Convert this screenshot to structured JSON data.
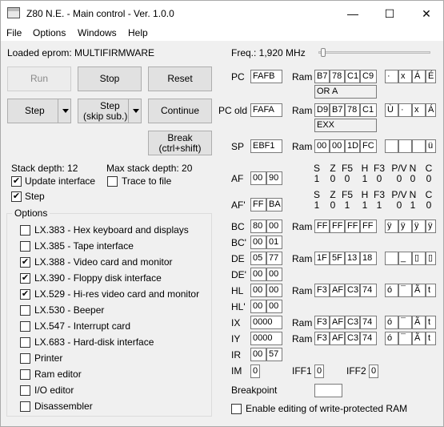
{
  "window": {
    "title": "Z80 N.E. - Main control - Ver. 1.0.0",
    "minimize": "—",
    "maximize": "☐",
    "close": "✕"
  },
  "menu": [
    "File",
    "Options",
    "Windows",
    "Help"
  ],
  "loaded": "Loaded eprom: MULTIFIRMWARE",
  "buttons": {
    "run": "Run",
    "stop": "Stop",
    "reset": "Reset",
    "step": "Step",
    "step_skip_1": "Step",
    "step_skip_2": "(skip sub.)",
    "continue": "Continue",
    "break_1": "Break",
    "break_2": "(ctrl+shift)"
  },
  "stack_depth": "Stack depth: 12",
  "max_stack_depth": "Max stack depth: 20",
  "update_interface": {
    "label": "Update interface",
    "checked": "✔"
  },
  "trace_to_file": {
    "label": "Trace to file",
    "checked": ""
  },
  "step_check": {
    "label": "Step",
    "checked": "✔"
  },
  "options": {
    "title": "Options",
    "items": [
      {
        "label": "LX.383 - Hex keyboard and displays",
        "checked": ""
      },
      {
        "label": "LX.385 - Tape interface",
        "checked": ""
      },
      {
        "label": "LX.388 - Video card and monitor",
        "checked": "✔"
      },
      {
        "label": "LX.390 - Floppy disk interface",
        "checked": "✔"
      },
      {
        "label": "LX.529 - Hi-res video card and monitor",
        "checked": "✔"
      },
      {
        "label": "LX.530 - Beeper",
        "checked": ""
      },
      {
        "label": "LX.547 - Interrupt card",
        "checked": ""
      },
      {
        "label": "LX.683 - Hard-disk interface",
        "checked": ""
      },
      {
        "label": "Printer",
        "checked": ""
      },
      {
        "label": "Ram editor",
        "checked": ""
      },
      {
        "label": "I/O editor",
        "checked": ""
      },
      {
        "label": "Disassembler",
        "checked": ""
      }
    ]
  },
  "freq": {
    "label": "Freq.: 1,920 MHz",
    "slider_fraction": 0.02
  },
  "regs": {
    "pc": {
      "label": "PC",
      "value": "FAFB",
      "ram_label": "Ram",
      "ram": [
        "B7",
        "78",
        "C1",
        "C9"
      ],
      "chars": [
        "·",
        "x",
        "Á",
        "É"
      ],
      "mnemonic": "OR A"
    },
    "pc_old": {
      "label": "PC old",
      "value": "FAFA",
      "ram_label": "Ram",
      "ram": [
        "D9",
        "B7",
        "78",
        "C1"
      ],
      "chars": [
        "Ù",
        "·",
        "x",
        "Á"
      ],
      "mnemonic": "EXX"
    },
    "sp": {
      "label": "SP",
      "value": "EBF1",
      "ram_label": "Ram",
      "ram": [
        "00",
        "00",
        "1D",
        "FC"
      ],
      "chars": [
        "",
        "",
        "",
        "ü"
      ]
    },
    "flag_names": [
      "S",
      "Z",
      "F5",
      "H",
      "F3",
      "P/V",
      "N",
      "C"
    ],
    "af": {
      "label": "AF",
      "v1": "00",
      "v2": "90",
      "flags": [
        "1",
        "0",
        "0",
        "1",
        "0",
        "0",
        "0",
        "0"
      ]
    },
    "af2": {
      "label": "AF'",
      "v1": "FF",
      "v2": "BA",
      "flags": [
        "1",
        "0",
        "1",
        "1",
        "1",
        "0",
        "1",
        "0"
      ]
    },
    "bc": {
      "label": "BC",
      "v1": "80",
      "v2": "00",
      "ram_label": "Ram",
      "ram": [
        "FF",
        "FF",
        "FF",
        "FF"
      ],
      "chars": [
        "ÿ",
        "ÿ",
        "ÿ",
        "ÿ"
      ]
    },
    "bc2": {
      "label": "BC'",
      "v1": "00",
      "v2": "01"
    },
    "de": {
      "label": "DE",
      "v1": "05",
      "v2": "77",
      "ram_label": "Ram",
      "ram": [
        "1F",
        "5F",
        "13",
        "18"
      ],
      "chars": [
        "",
        "_",
        "▯",
        "▯"
      ]
    },
    "de2": {
      "label": "DE'",
      "v1": "00",
      "v2": "00"
    },
    "hl": {
      "label": "HL",
      "v1": "00",
      "v2": "00",
      "ram_label": "Ram",
      "ram": [
        "F3",
        "AF",
        "C3",
        "74"
      ],
      "chars": [
        "ó",
        "¯",
        "Ã",
        "t"
      ]
    },
    "hl2": {
      "label": "HL'",
      "v1": "00",
      "v2": "00"
    },
    "ix": {
      "label": "IX",
      "value": "0000",
      "ram_label": "Ram",
      "ram": [
        "F3",
        "AF",
        "C3",
        "74"
      ],
      "chars": [
        "ó",
        "¯",
        "Ã",
        "t"
      ]
    },
    "iy": {
      "label": "IY",
      "value": "0000",
      "ram_label": "Ram",
      "ram": [
        "F3",
        "AF",
        "C3",
        "74"
      ],
      "chars": [
        "ó",
        "¯",
        "Ã",
        "t"
      ]
    },
    "ir": {
      "label": "IR",
      "v1": "00",
      "v2": "57"
    },
    "im": {
      "label": "IM",
      "value": "0"
    },
    "iff1": {
      "label": "IFF1",
      "value": "0"
    },
    "iff2": {
      "label": "IFF2",
      "value": "0"
    }
  },
  "breakpoint": {
    "label": "Breakpoint",
    "value": ""
  },
  "write_protect": {
    "label": "Enable editing of write-protected RAM",
    "checked": ""
  }
}
